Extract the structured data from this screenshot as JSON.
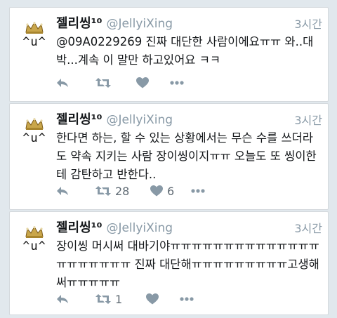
{
  "tweets": [
    {
      "display_name": "젤리씽¹⁰",
      "handle": "@JellyiXing",
      "time": "3시간",
      "avatar_face": "^u^",
      "text": "@09A0229269 진짜 대단한 사람이에요ㅠㅠ 와..대박...계속 이 말만 하고있어요 ㅋㅋ",
      "retweet_count": "",
      "like_count": ""
    },
    {
      "display_name": "젤리씽¹⁰",
      "handle": "@JellyiXing",
      "time": "3시간",
      "avatar_face": "^u^",
      "text": "한다면 하는, 할 수 있는 상황에서는 무슨 수를 쓰더라도 약속 지키는 사람 장이씽이지ㅠㅠ 오늘도 또 씽이한테 감탄하고 반한다..",
      "retweet_count": "28",
      "like_count": "6"
    },
    {
      "display_name": "젤리씽¹⁰",
      "handle": "@JellyiXing",
      "time": "3시간",
      "avatar_face": "^u^",
      "text": "장이씽 머시써 대바기야ㅠㅠㅠㅠㅠㅠㅠㅠㅠㅠㅠㅠㅠㅠㅠㅠㅠㅠㅠㅠㅠ 진짜 대단해ㅠㅠㅠㅠㅠㅠㅠㅠㅠ고생해써ㅠㅠㅠㅠㅠ",
      "retweet_count": "1",
      "like_count": ""
    }
  ],
  "icons": {
    "reply": "reply-icon",
    "retweet": "retweet-icon",
    "like": "heart-icon",
    "more": "more-icon"
  },
  "colors": {
    "background": "#e1e8ed",
    "card": "#ffffff",
    "text": "#14171a",
    "muted": "#8899a6"
  }
}
